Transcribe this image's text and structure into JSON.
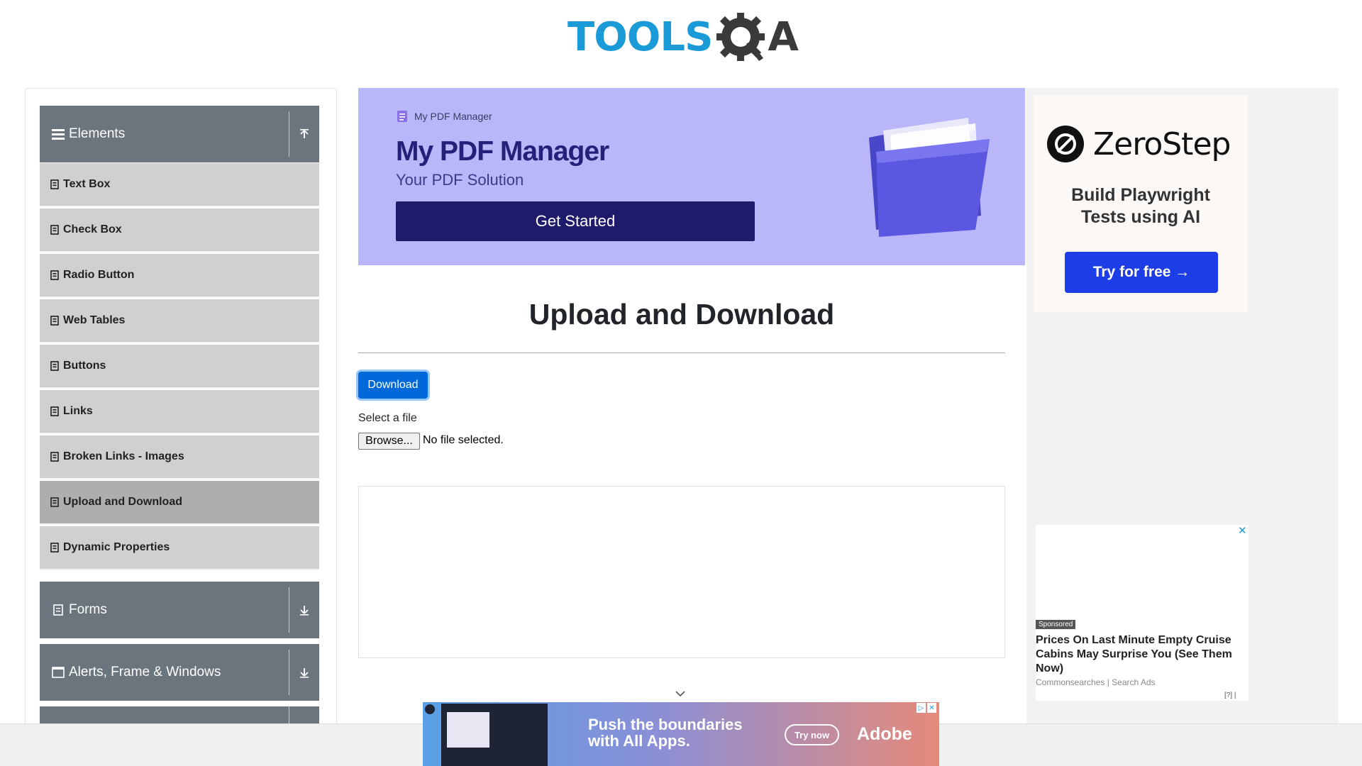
{
  "header": {
    "logo_text": "TOOLS",
    "logo_suffix": "A"
  },
  "sidebar": {
    "groups": [
      {
        "label": "Elements",
        "icon": "hamburger-icon",
        "toggle": "collapse-arrow-icon"
      },
      {
        "label": "Forms",
        "icon": "form-icon",
        "toggle": "expand-arrow-icon"
      },
      {
        "label": "Alerts, Frame & Windows",
        "icon": "window-icon",
        "toggle": "expand-arrow-icon"
      }
    ],
    "items": [
      {
        "label": "Text Box"
      },
      {
        "label": "Check Box"
      },
      {
        "label": "Radio Button"
      },
      {
        "label": "Web Tables"
      },
      {
        "label": "Buttons"
      },
      {
        "label": "Links"
      },
      {
        "label": "Broken Links - Images"
      },
      {
        "label": "Upload and Download",
        "active": true
      },
      {
        "label": "Dynamic Properties"
      }
    ]
  },
  "ad_pdf": {
    "brand": "My PDF Manager",
    "title": "My PDF Manager",
    "subtitle": "Your PDF Solution",
    "cta": "Get Started"
  },
  "main": {
    "title": "Upload and Download",
    "download_label": "Download",
    "select_label": "Select a file",
    "browse_label": "Browse...",
    "file_status": "No file selected."
  },
  "ad_zerostep": {
    "brand": "ZeroStep",
    "tagline_1": "Build Playwright",
    "tagline_2": "Tests using AI",
    "cta": "Try for free →"
  },
  "ad_sponsored": {
    "badge": "Sponsored",
    "headline": "Prices On Last Minute Empty Cruise Cabins May Surprise You (See Them Now)",
    "source": "Commonsearches | Search Ads",
    "info": "[?] |",
    "close": "✕"
  },
  "ad_adobe": {
    "line1": "Push the boundaries",
    "line2": "with All Apps.",
    "cta": "Try now",
    "brand": "Adobe",
    "choices_1": "▷",
    "choices_2": "✕"
  },
  "colors": {
    "accent": "#0069d9",
    "sidebar_header": "#6c757d",
    "sidebar_item": "#d0d0d0",
    "logo_blue": "#1a9bd7"
  }
}
